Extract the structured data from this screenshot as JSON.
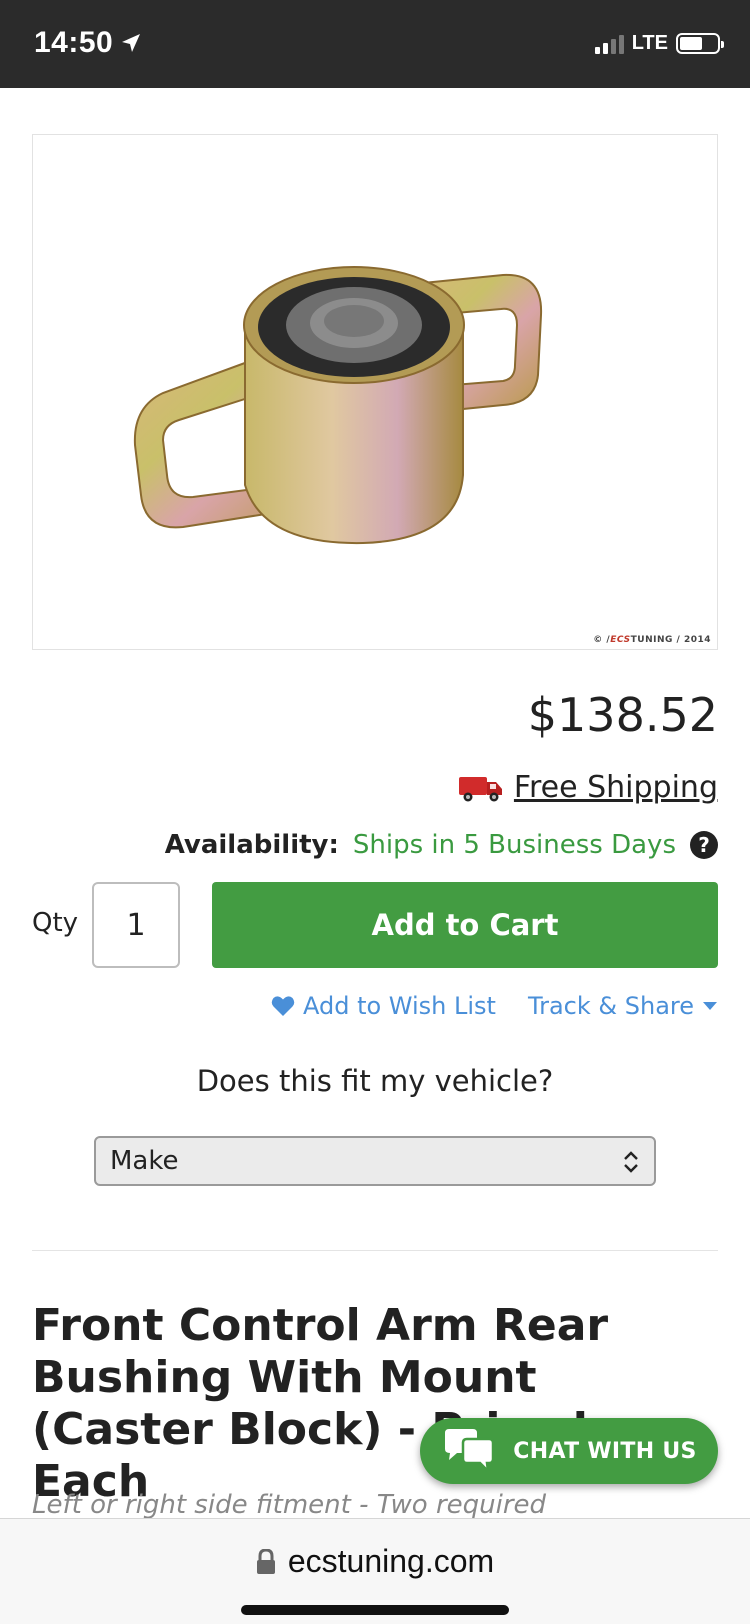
{
  "status_bar": {
    "time": "14:50",
    "network": "LTE"
  },
  "product": {
    "image_alt": "Front control arm rear bushing with mount",
    "watermark_prefix": "© /",
    "watermark_brand": "ECS",
    "watermark_suffix": "TUNING / 2014",
    "price": "$138.52",
    "shipping_label": "Free Shipping",
    "availability_label": "Availability:",
    "availability_value": "Ships in 5 Business Days",
    "help_symbol": "?",
    "qty_label": "Qty",
    "qty_value": "1",
    "add_to_cart": "Add to Cart",
    "wish_list": "Add to Wish List",
    "track_share": "Track & Share",
    "fit_question": "Does this fit my vehicle?",
    "make_select": "Make",
    "title": "Front Control Arm Rear Bushing With Mount (Caster Block) - Priced Each",
    "fitment_note": "Left or right side fitment - Two required"
  },
  "chat": {
    "label": "CHAT WITH US"
  },
  "browser": {
    "url": "ecstuning.com"
  },
  "colors": {
    "accent_green": "#439c42",
    "link_blue": "#4a8fd8",
    "availability_green": "#3a9a40"
  }
}
